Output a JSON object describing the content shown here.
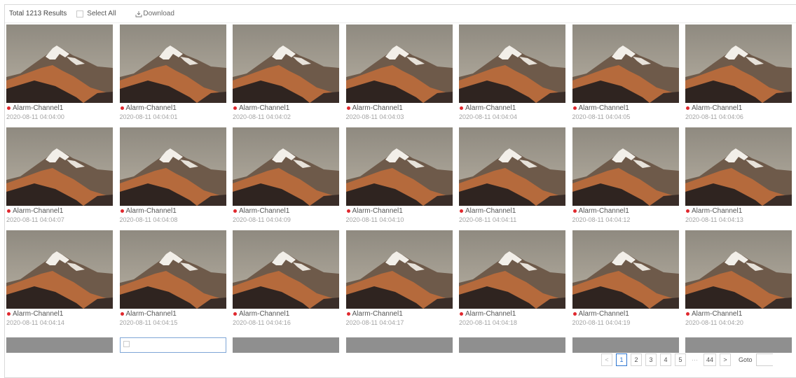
{
  "toolbar": {
    "total_label": "Total 1213 Results",
    "select_all_label": "Select All",
    "download_label": "Download"
  },
  "colors": {
    "alarm_dot": "#e0282e",
    "active_page": "#2e76d1",
    "selected_border": "#7fa6d6"
  },
  "icons": {
    "download": "download-icon",
    "alarm": "red-dot-icon",
    "prev": "chevron-left-icon",
    "next": "chevron-right-icon"
  },
  "results": [
    {
      "channel": "Alarm-Channel1",
      "time": "2020-08-11 04:04:00"
    },
    {
      "channel": "Alarm-Channel1",
      "time": "2020-08-11 04:04:01"
    },
    {
      "channel": "Alarm-Channel1",
      "time": "2020-08-11 04:04:02"
    },
    {
      "channel": "Alarm-Channel1",
      "time": "2020-08-11 04:04:03"
    },
    {
      "channel": "Alarm-Channel1",
      "time": "2020-08-11 04:04:04"
    },
    {
      "channel": "Alarm-Channel1",
      "time": "2020-08-11 04:04:05"
    },
    {
      "channel": "Alarm-Channel1",
      "time": "2020-08-11 04:04:06"
    },
    {
      "channel": "Alarm-Channel1",
      "time": "2020-08-11 04:04:07"
    },
    {
      "channel": "Alarm-Channel1",
      "time": "2020-08-11 04:04:08"
    },
    {
      "channel": "Alarm-Channel1",
      "time": "2020-08-11 04:04:09"
    },
    {
      "channel": "Alarm-Channel1",
      "time": "2020-08-11 04:04:10"
    },
    {
      "channel": "Alarm-Channel1",
      "time": "2020-08-11 04:04:11"
    },
    {
      "channel": "Alarm-Channel1",
      "time": "2020-08-11 04:04:12"
    },
    {
      "channel": "Alarm-Channel1",
      "time": "2020-08-11 04:04:13"
    },
    {
      "channel": "Alarm-Channel1",
      "time": "2020-08-11 04:04:14"
    },
    {
      "channel": "Alarm-Channel1",
      "time": "2020-08-11 04:04:15"
    },
    {
      "channel": "Alarm-Channel1",
      "time": "2020-08-11 04:04:16"
    },
    {
      "channel": "Alarm-Channel1",
      "time": "2020-08-11 04:04:17"
    },
    {
      "channel": "Alarm-Channel1",
      "time": "2020-08-11 04:04:18"
    },
    {
      "channel": "Alarm-Channel1",
      "time": "2020-08-11 04:04:19"
    },
    {
      "channel": "Alarm-Channel1",
      "time": "2020-08-11 04:04:20"
    }
  ],
  "pagination": {
    "prev": "<",
    "pages": [
      "1",
      "2",
      "3",
      "4",
      "5"
    ],
    "active_page": "1",
    "ellipsis": "···",
    "last_page": "44",
    "next": ">",
    "goto_label": "Goto",
    "goto_value": ""
  }
}
